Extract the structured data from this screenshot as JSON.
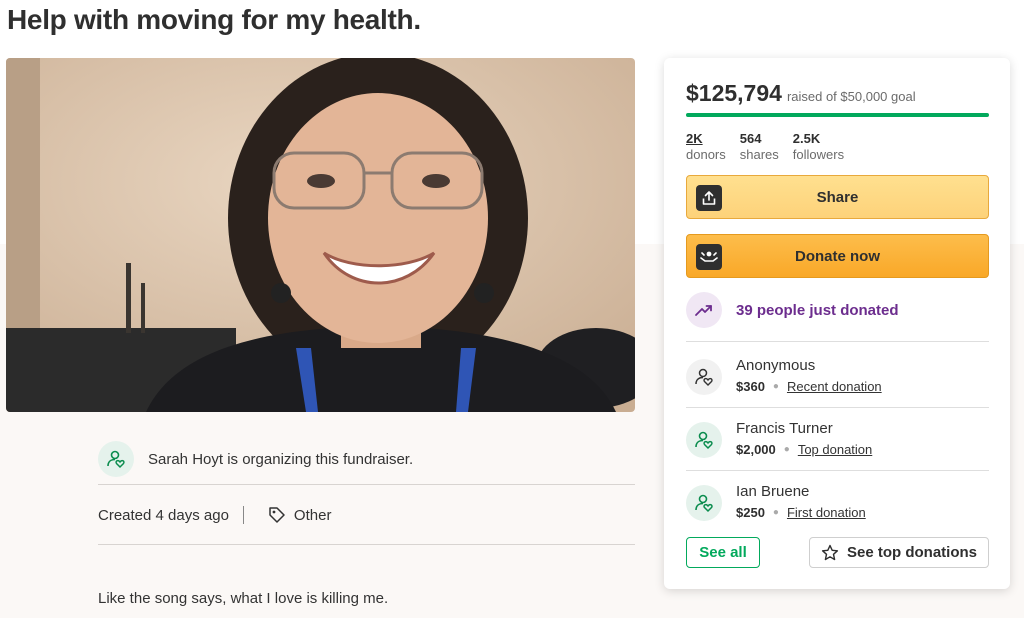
{
  "page": {
    "title": "Help with moving for my health."
  },
  "organizer": {
    "text": "Sarah Hoyt is organizing this fundraiser."
  },
  "meta": {
    "created": "Created 4 days ago",
    "category": "Other"
  },
  "story": {
    "first_line": "Like the song says, what I love is killing me."
  },
  "donation_card": {
    "amount": "$125,794",
    "goal": "raised of $50,000 goal",
    "progress_fraction": 1.0,
    "stats": [
      {
        "value": "2K",
        "label": "donors"
      },
      {
        "value": "564",
        "label": "shares"
      },
      {
        "value": "2.5K",
        "label": "followers"
      }
    ],
    "share_label": "Share",
    "donate_label": "Donate now",
    "recent_activity": "39 people just donated",
    "donations": [
      {
        "name": "Anonymous",
        "amount": "$360",
        "tag": "Recent donation"
      },
      {
        "name": "Francis Turner",
        "amount": "$2,000",
        "tag": "Top donation"
      },
      {
        "name": "Ian Bruene",
        "amount": "$250",
        "tag": "First donation"
      }
    ],
    "see_all_label": "See all",
    "see_top_label": "See top donations"
  },
  "colors": {
    "brand_green": "#02a95c",
    "donate_orange": "#f9a828",
    "activity_purple": "#6c2d8e"
  },
  "icons": {
    "organizer": "user-heart-icon",
    "category": "tag-icon",
    "share": "upload-icon",
    "donate": "donate-hands-icon",
    "activity": "trending-up-icon",
    "top_donations": "star-icon"
  }
}
